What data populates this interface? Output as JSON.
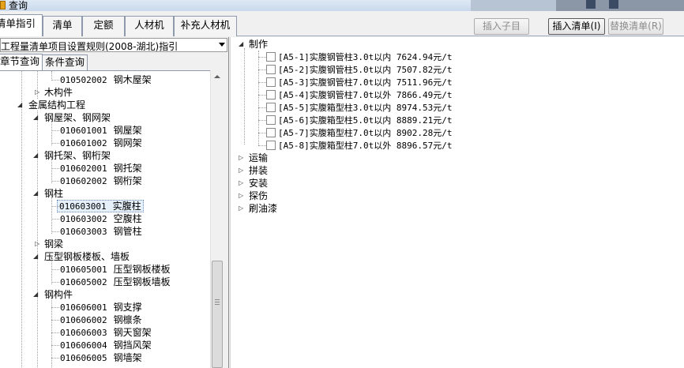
{
  "window": {
    "title": "查询"
  },
  "tabs": [
    {
      "label": "清单指引"
    },
    {
      "label": "清单"
    },
    {
      "label": "定额"
    },
    {
      "label": "人材机"
    },
    {
      "label": "补充人材机"
    }
  ],
  "buttons": {
    "insert_child": "插入子目",
    "insert_list": "插入清单(I)",
    "replace_list": "替换清单(R)"
  },
  "left": {
    "rule_select": "工程量清单项目设置规则(2008-湖北)指引",
    "subtabs": [
      "章节查询",
      "条件查询"
    ],
    "tree": [
      {
        "code": "010502002",
        "name": "钢木屋架"
      },
      {
        "name": "木构件"
      },
      {
        "name": "金属结构工程"
      },
      {
        "name": "钢屋架、钢网架"
      },
      {
        "code": "010601001",
        "name": "钢屋架"
      },
      {
        "code": "010601002",
        "name": "钢网架"
      },
      {
        "name": "钢托架、钢桁架"
      },
      {
        "code": "010602001",
        "name": "钢托架"
      },
      {
        "code": "010602002",
        "name": "钢桁架"
      },
      {
        "name": "钢柱"
      },
      {
        "code": "010603001",
        "name": "实腹柱"
      },
      {
        "code": "010603002",
        "name": "空腹柱"
      },
      {
        "code": "010603003",
        "name": "钢管柱"
      },
      {
        "name": "钢梁"
      },
      {
        "name": "压型钢板楼板、墙板"
      },
      {
        "code": "010605001",
        "name": "压型钢板楼板"
      },
      {
        "code": "010605002",
        "name": "压型钢板墙板"
      },
      {
        "name": "钢构件"
      },
      {
        "code": "010606001",
        "name": "钢支撑"
      },
      {
        "code": "010606002",
        "name": "钢檩条"
      },
      {
        "code": "010606003",
        "name": "钢天窗架"
      },
      {
        "code": "010606004",
        "name": "钢挡风架"
      },
      {
        "code": "010606005",
        "name": "钢墙架"
      }
    ]
  },
  "right": {
    "groups": [
      "制作",
      "运输",
      "拼装",
      "安装",
      "探伤",
      "刷油漆"
    ],
    "items": [
      {
        "text": "[A5-1]实腹钢管柱3.0t以内 7624.94元/t"
      },
      {
        "text": "[A5-2]实腹钢管柱5.0t以内 7507.82元/t"
      },
      {
        "text": "[A5-3]实腹钢管柱7.0t以内 7511.96元/t"
      },
      {
        "text": "[A5-4]实腹钢管柱7.0t以外 7866.49元/t"
      },
      {
        "text": "[A5-5]实腹箱型柱3.0t以内 8974.53元/t"
      },
      {
        "text": "[A5-6]实腹箱型柱5.0t以内 8889.21元/t"
      },
      {
        "text": "[A5-7]实腹箱型柱7.0t以内 8902.28元/t"
      },
      {
        "text": "[A5-8]实腹箱型柱7.0t以外 8896.57元/t"
      }
    ]
  }
}
